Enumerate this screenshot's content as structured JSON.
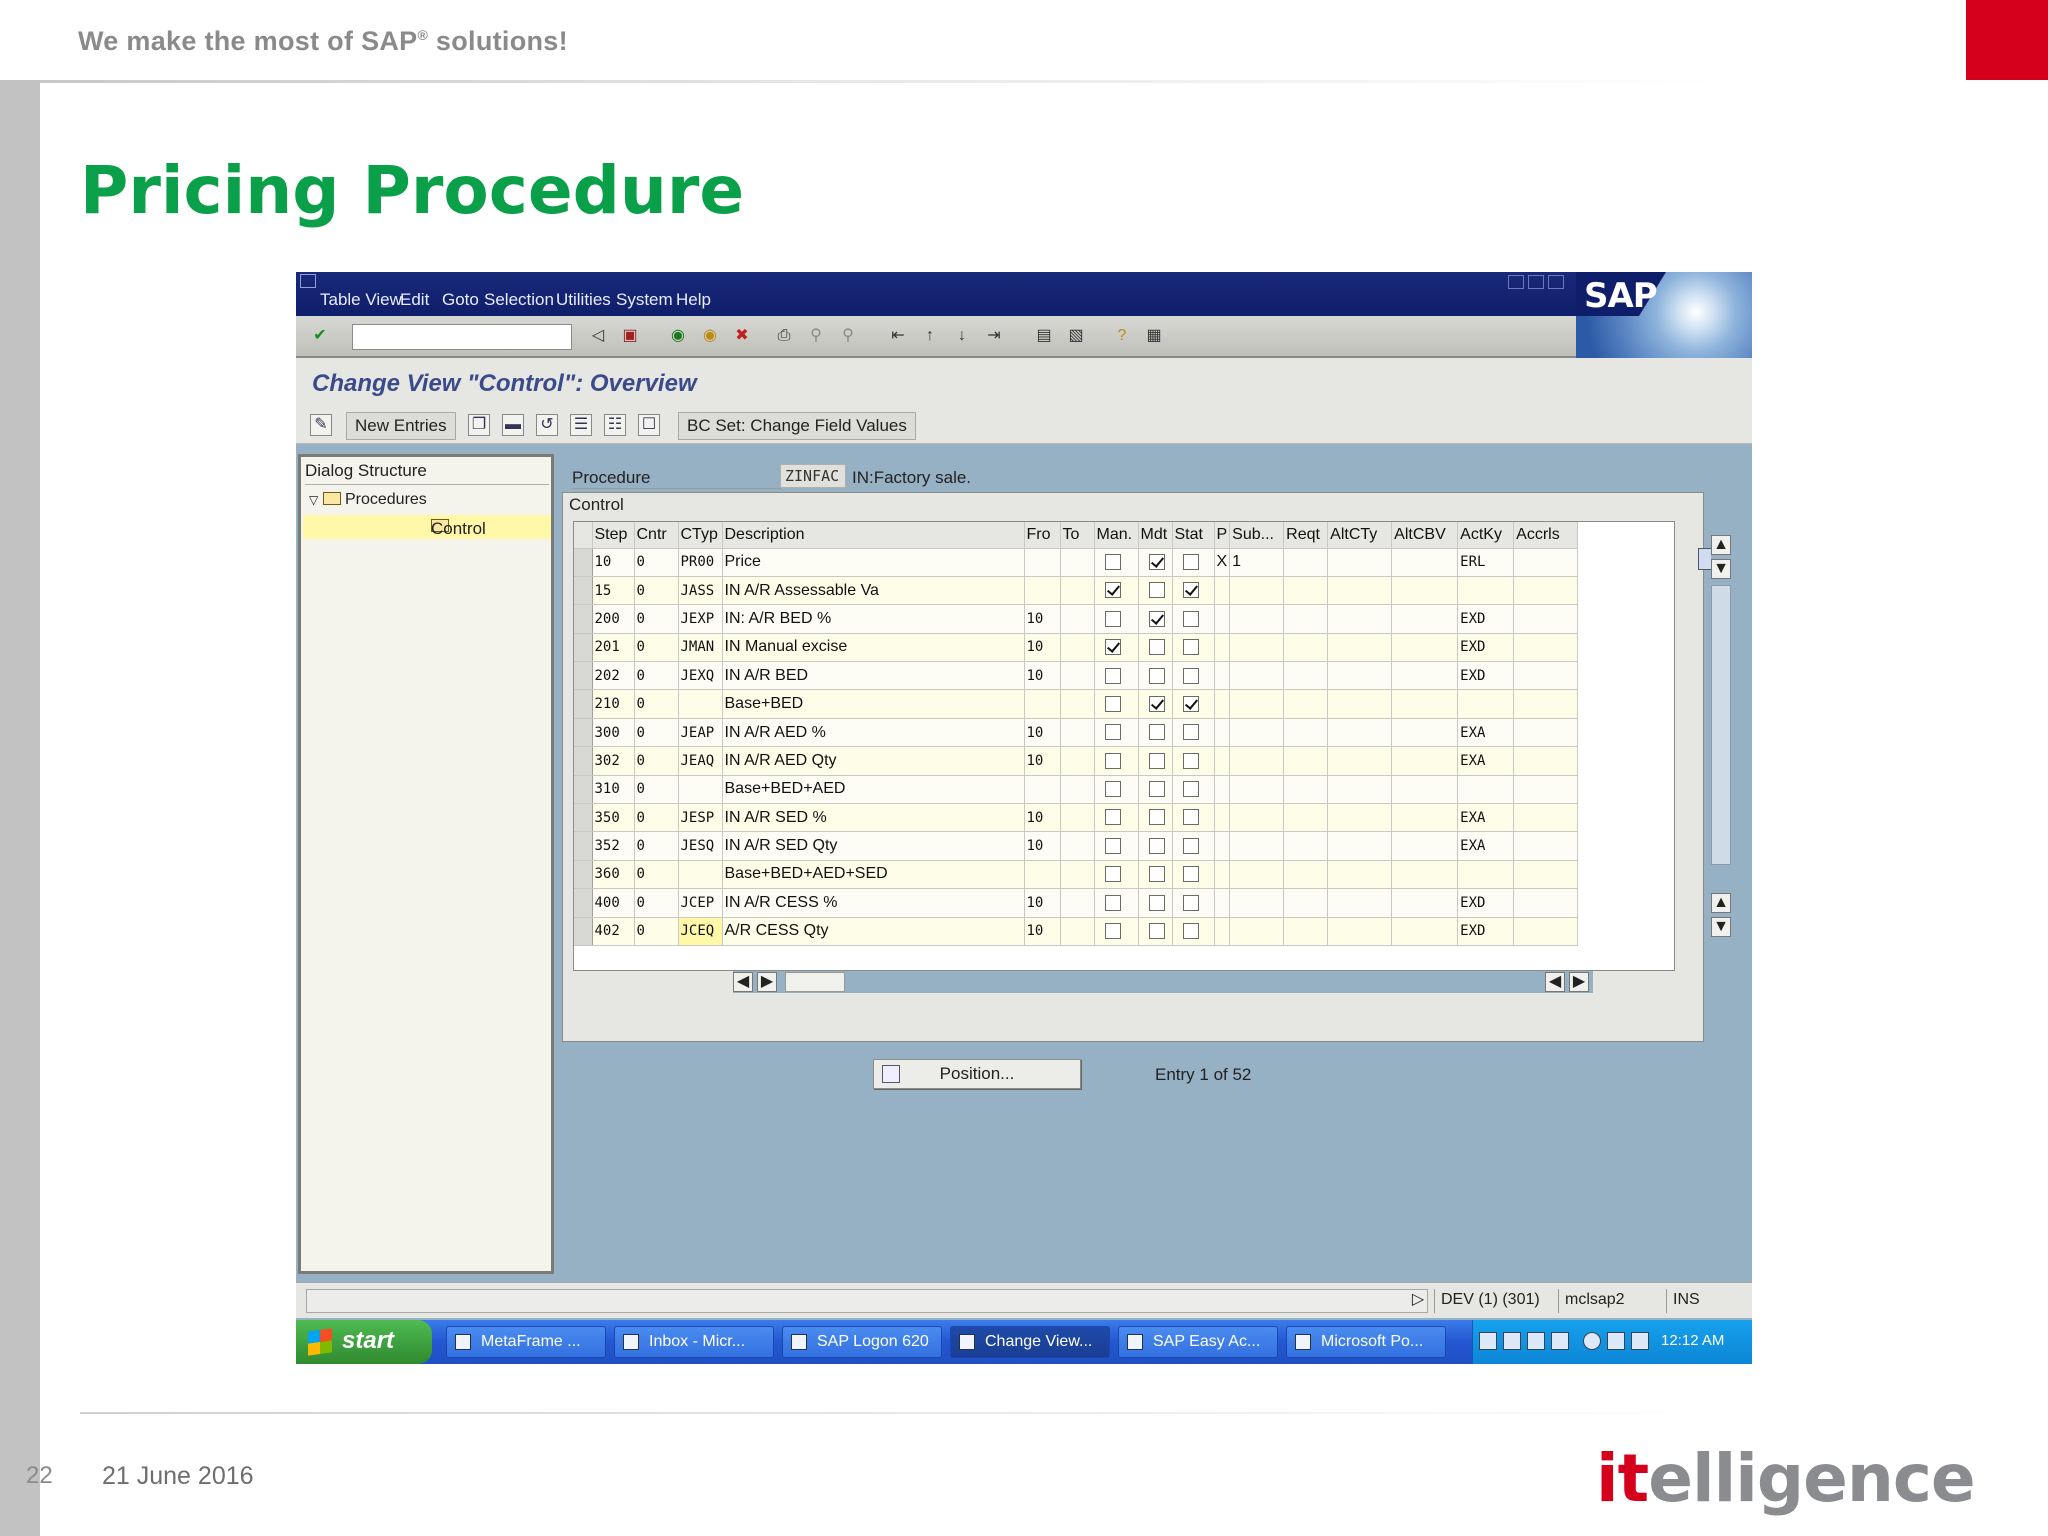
{
  "slide": {
    "tagline": "We make the most of SAP",
    "tagline_reg": "®",
    "tagline_end": " solutions!",
    "title": "Pricing Procedure",
    "page_number": "22",
    "date": "21 June 2016",
    "logo_it": "it",
    "logo_rest": "elligence",
    "accent_color": "#d5001c",
    "title_color": "#0aa04a"
  },
  "sap": {
    "menu": [
      "Table View",
      "Edit",
      "Goto",
      "Selection",
      "Utilities",
      "System",
      "Help"
    ],
    "logo": "SAP",
    "screen_title": "Change View \"Control\": Overview",
    "app_toolbar": {
      "new_entries": "New Entries",
      "bc_set": "BC Set: Change Field Values"
    },
    "dialog_structure": {
      "header": "Dialog Structure",
      "node_procedures": "Procedures",
      "node_control": "Control"
    },
    "procedure": {
      "label": "Procedure",
      "value": "ZINFAC",
      "description": "IN:Factory sale."
    },
    "control_tab": "Control",
    "columns": [
      "Step",
      "Cntr",
      "CTyp",
      "Description",
      "Fro",
      "To",
      "Man.",
      "Mdt",
      "Stat",
      "P",
      "Sub...",
      "Reqt",
      "AltCTy",
      "AltCBV",
      "ActKy",
      "Accrls"
    ],
    "rows": [
      {
        "step": "10",
        "cntr": "0",
        "ctyp": "PR00",
        "desc": "Price",
        "fro": "",
        "to": "",
        "man": false,
        "mdt": true,
        "stat": false,
        "p": "X",
        "sub": "1",
        "actky": "ERL"
      },
      {
        "step": "15",
        "cntr": "0",
        "ctyp": "JASS",
        "desc": "IN A/R Assessable Va",
        "fro": "",
        "to": "",
        "man": true,
        "mdt": false,
        "stat": true,
        "p": "",
        "sub": "",
        "actky": ""
      },
      {
        "step": "200",
        "cntr": "0",
        "ctyp": "JEXP",
        "desc": "IN: A/R BED %",
        "fro": "10",
        "to": "",
        "man": false,
        "mdt": true,
        "stat": false,
        "p": "",
        "sub": "",
        "actky": "EXD"
      },
      {
        "step": "201",
        "cntr": "0",
        "ctyp": "JMAN",
        "desc": "IN Manual excise",
        "fro": "10",
        "to": "",
        "man": true,
        "mdt": false,
        "stat": false,
        "p": "",
        "sub": "",
        "actky": "EXD"
      },
      {
        "step": "202",
        "cntr": "0",
        "ctyp": "JEXQ",
        "desc": "IN A/R BED",
        "fro": "10",
        "to": "",
        "man": false,
        "mdt": false,
        "stat": false,
        "p": "",
        "sub": "",
        "actky": "EXD"
      },
      {
        "step": "210",
        "cntr": "0",
        "ctyp": "",
        "desc": "Base+BED",
        "fro": "",
        "to": "",
        "man": false,
        "mdt": true,
        "stat": true,
        "p": "",
        "sub": "",
        "actky": ""
      },
      {
        "step": "300",
        "cntr": "0",
        "ctyp": "JEAP",
        "desc": "IN A/R AED %",
        "fro": "10",
        "to": "",
        "man": false,
        "mdt": false,
        "stat": false,
        "p": "",
        "sub": "",
        "actky": "EXA"
      },
      {
        "step": "302",
        "cntr": "0",
        "ctyp": "JEAQ",
        "desc": "IN A/R AED Qty",
        "fro": "10",
        "to": "",
        "man": false,
        "mdt": false,
        "stat": false,
        "p": "",
        "sub": "",
        "actky": "EXA"
      },
      {
        "step": "310",
        "cntr": "0",
        "ctyp": "",
        "desc": "Base+BED+AED",
        "fro": "",
        "to": "",
        "man": false,
        "mdt": false,
        "stat": false,
        "p": "",
        "sub": "",
        "actky": ""
      },
      {
        "step": "350",
        "cntr": "0",
        "ctyp": "JESP",
        "desc": "IN A/R SED %",
        "fro": "10",
        "to": "",
        "man": false,
        "mdt": false,
        "stat": false,
        "p": "",
        "sub": "",
        "actky": "EXA"
      },
      {
        "step": "352",
        "cntr": "0",
        "ctyp": "JESQ",
        "desc": "IN A/R SED Qty",
        "fro": "10",
        "to": "",
        "man": false,
        "mdt": false,
        "stat": false,
        "p": "",
        "sub": "",
        "actky": "EXA"
      },
      {
        "step": "360",
        "cntr": "0",
        "ctyp": "",
        "desc": "Base+BED+AED+SED",
        "fro": "",
        "to": "",
        "man": false,
        "mdt": false,
        "stat": false,
        "p": "",
        "sub": "",
        "actky": ""
      },
      {
        "step": "400",
        "cntr": "0",
        "ctyp": "JCEP",
        "desc": "IN A/R CESS %",
        "fro": "10",
        "to": "",
        "man": false,
        "mdt": false,
        "stat": false,
        "p": "",
        "sub": "",
        "actky": "EXD"
      },
      {
        "step": "402",
        "cntr": "0",
        "ctyp": "JCEQ",
        "desc": "A/R CESS Qty",
        "fro": "10",
        "to": "",
        "man": false,
        "mdt": false,
        "stat": false,
        "p": "",
        "sub": "",
        "actky": "EXD"
      }
    ],
    "position_button": "Position...",
    "entry_info": "Entry 1 of 52",
    "status": {
      "system": "DEV (1) (301)",
      "server": "mclsap2",
      "mode": "INS"
    }
  },
  "taskbar": {
    "start": "start",
    "tasks": [
      "MetaFrame ...",
      "Inbox - Micr...",
      "SAP Logon 620",
      "Change View...",
      "SAP Easy Ac...",
      "Microsoft Po..."
    ],
    "clock": "12:12 AM"
  }
}
